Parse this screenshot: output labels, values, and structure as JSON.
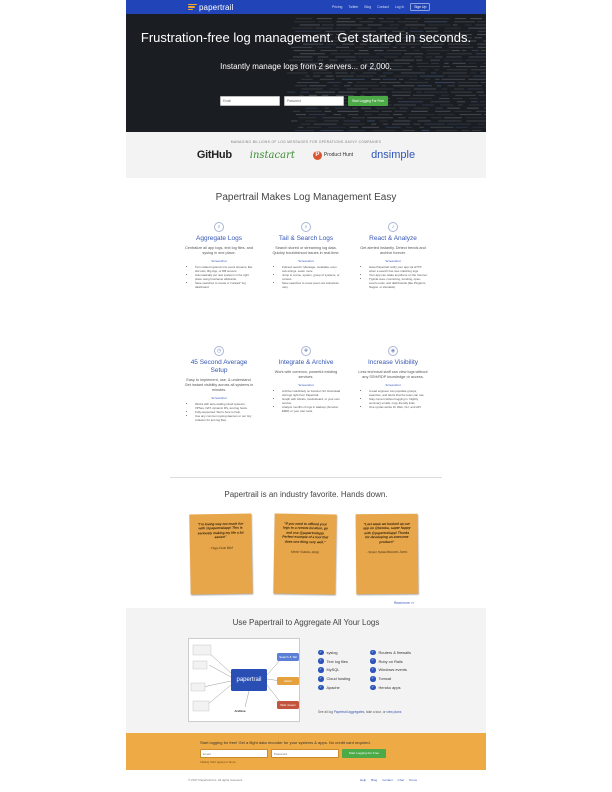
{
  "nav": {
    "brand": "papertrail",
    "links": [
      "Pricing",
      "Twitter",
      "Blog",
      "Contact",
      "Log In"
    ],
    "signup": "Sign Up",
    "colors": {
      "bar": "#2145b8",
      "logo_accent": "#f3a630"
    }
  },
  "hero": {
    "title": "Frustration-free log management. Get started in seconds.",
    "subtitle": "Instantly manage logs from 2 servers... or 2,000.",
    "email_placeholder": "Email",
    "password_placeholder": "Password",
    "cta": "Start Logging For Free"
  },
  "customers": {
    "caption": "MANAGING BILLIONS OF LOG MESSAGES FOR OPERATIONS-SAVVY COMPANIES",
    "logos": [
      "GitHub",
      "instacart",
      "P",
      "Product Hunt",
      "dnsimple"
    ]
  },
  "features": {
    "title": "Papertrail Makes Log Management Easy",
    "screenshot_label": "Screenshot",
    "items": [
      {
        "icon": "search-icon",
        "title": "Aggregate Logs",
        "desc": "Centralize all app logs, text log files, and syslog in one place.",
        "bullets": [
          "Turn related systems into event streams, like HA Lists, Big App, or DB servers.",
          "Automatically put new systems in the right place using hostname wildcards.",
          "Save searches to create a \"curated\" log dashboard."
        ]
      },
      {
        "icon": "search-icon",
        "title": "Tail & Search Logs",
        "desc": "Search stored or streaming log data. Quickly troubleshoot issues in real-time.",
        "bullets": [
          "Full-text search. Message, metadata, even sub-strings. Learn more",
          "Jump to a time, system, group of systems, or context.",
          "Save searches to reuse (even via colourless use)."
        ]
      },
      {
        "icon": "bell-icon",
        "title": "React & Analyze",
        "desc": "Get alerted instantly. Detect trends and archive forever.",
        "bullets": [
          "Have Papertrail notify your app via HTTP when a search has new matching logs.",
          "Your app can relate anywhere on the Internet.",
          "Typical uses: monitoring, trending, open-source tools, and dashboards (like Pingdom, Nagios, or Zendesk)."
        ]
      },
      {
        "icon": "clock-icon",
        "title": "45 Second Average Setup",
        "desc": "Easy to implement, use, & understand. Get instant visibility across all systems in minutes.",
        "bullets": [
          "Works with auto-scaling cloud systems, VPSes, NAT, dynamic IPs, and log hosts.",
          "Fully-supported. We're here to help.",
          "Use any common syslog daemon or our tiny collector for text log files."
        ]
      },
      {
        "icon": "puzzle-icon",
        "title": "Integrate & Archive",
        "desc": "Work with common, powerful existing services.",
        "bullets": [
          "Archive indefinitely on Amazon S3. Download old logs right from Papertrail.",
          "Graph with Librato, Geckoboard, or your own service.",
          "Analyze months of logs in Hadoop (Amazon EMR) or your own tools."
        ]
      },
      {
        "icon": "eye-icon",
        "title": "Increase Visibility",
        "desc": "Less technical staff can view logs without any SSH/RDP knowledge or access.",
        "bullets": [
          "A lead engineer can populate groups, searches, and alerts that the team can use.",
          "Stay current without logging in. Nightly summary emails, copy-friendly links.",
          "One syntax works for Web, CLI, and API."
        ]
      }
    ]
  },
  "testimonials": {
    "title": "Papertrail is an industry favorite. Hands down.",
    "notes": [
      {
        "quote": "\"I'm loving way too much fun with @papertrailapp! This is seriously making my life a lot easier!\"",
        "author": "- Tiago Ferlo Bilof"
      },
      {
        "quote": "\"If you need to offload your logs to a remote location, go and use @papertrailapp. Perfect example of a tool that does one thing very well.\"",
        "author": "Martin Sokolov Bolds"
      },
      {
        "quote": "\"Last week we hooked up our app on @heroku, super happy with @papertrailapp! Thanks for developing an awesome product!\"",
        "author": "- Simon Tamez Brennes Jones"
      }
    ],
    "read_more": "Read more >>",
    "note_color": "#e8a64a"
  },
  "aggregate": {
    "title": "Use Papertrail to Aggregate All Your Logs",
    "diagram": {
      "brand": "papertrail",
      "nodes": [
        "Search & Tail",
        "Alerts",
        "Archive",
        "Web viewer"
      ]
    },
    "col1": [
      "syslog",
      "Text log files",
      "MySQL",
      "Cloud hosting",
      "Apache"
    ],
    "col2": [
      "Routers & firewalls",
      "Ruby on Rails",
      "Windows events",
      "Tomcat",
      "Heroku apps"
    ],
    "footer_pre": "See all log",
    "footer_link1": "Papertrail aggregates",
    "footer_mid": ", take a tour, or",
    "footer_link2": "view plans"
  },
  "cta": {
    "text": "Start logging for free! Get a flight data recorder for your systems & apps. No credit card required.",
    "email_placeholder": "Email",
    "password_placeholder": "Password",
    "button": "Start Logging For Free",
    "legal_pre": "Clicking 'Start' agrees to",
    "legal_link": "Terms",
    "color": "#eeaa44"
  },
  "footer": {
    "copyright": "© 2017 Papertrail Inc. All rights reserved.",
    "links": [
      "Help",
      "Blog",
      "Contact",
      "Chat",
      "Terms"
    ]
  }
}
